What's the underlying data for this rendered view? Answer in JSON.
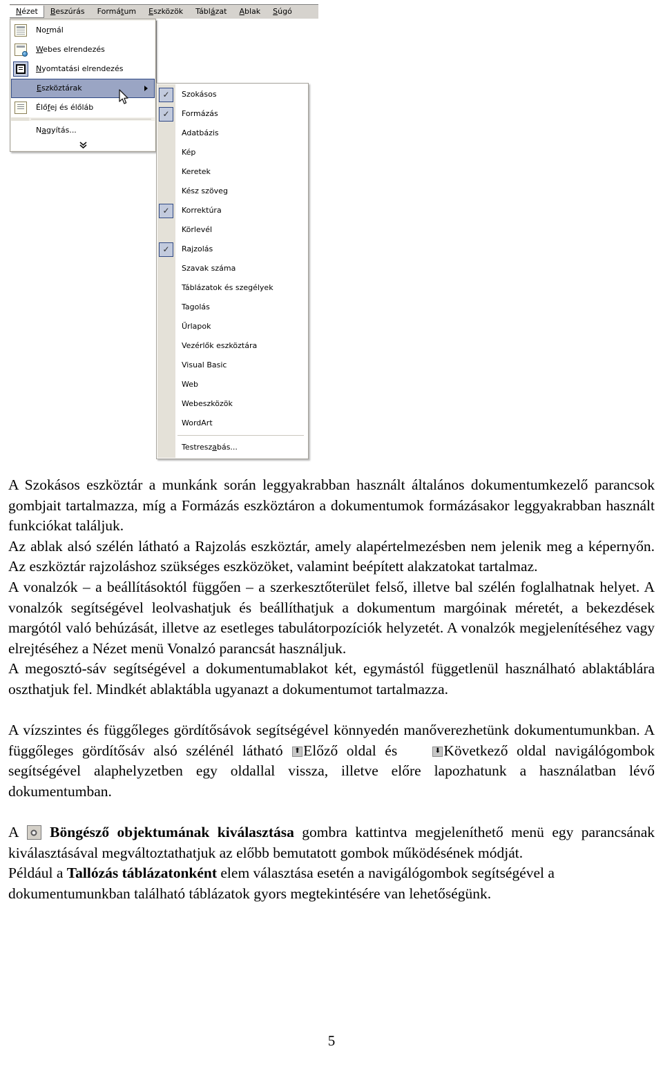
{
  "menubar": {
    "items": [
      {
        "label": "Nézet",
        "accel": "N",
        "active": true
      },
      {
        "label": "Beszúrás",
        "accel": "B",
        "active": false
      },
      {
        "label": "Formátum",
        "accel": "t",
        "active": false
      },
      {
        "label": "Eszközök",
        "accel": "E",
        "active": false
      },
      {
        "label": "Táblázat",
        "accel": "á",
        "active": false
      },
      {
        "label": "Ablak",
        "accel": "A",
        "active": false
      },
      {
        "label": "Súgó",
        "accel": "S",
        "active": false
      }
    ]
  },
  "view_menu": {
    "items": [
      {
        "label": "Normál",
        "icon": "normal-view-icon",
        "highlight": false,
        "submenu": false
      },
      {
        "label": "Webes elrendezés",
        "icon": "web-layout-icon",
        "highlight": false,
        "submenu": false
      },
      {
        "label": "Nyomtatási elrendezés",
        "icon": "print-layout-icon",
        "highlight": false,
        "submenu": false
      },
      {
        "label": "Eszköztárak",
        "icon": "",
        "highlight": true,
        "submenu": true
      },
      {
        "label": "Élőfej és élőláb",
        "icon": "header-footer-icon",
        "highlight": false,
        "submenu": false
      },
      {
        "label": "Nagyítás...",
        "icon": "",
        "highlight": false,
        "submenu": false
      }
    ],
    "expand_glyph": "⌄⌄"
  },
  "toolbars_submenu": {
    "items": [
      {
        "label": "Szokásos",
        "checked": true
      },
      {
        "label": "Formázás",
        "checked": true
      },
      {
        "label": "Adatbázis",
        "checked": false
      },
      {
        "label": "Kép",
        "checked": false
      },
      {
        "label": "Keretek",
        "checked": false
      },
      {
        "label": "Kész szöveg",
        "checked": false
      },
      {
        "label": "Korrektúra",
        "checked": true
      },
      {
        "label": "Körlevél",
        "checked": false
      },
      {
        "label": "Rajzolás",
        "checked": true
      },
      {
        "label": "Szavak száma",
        "checked": false
      },
      {
        "label": "Táblázatok és szegélyek",
        "checked": false
      },
      {
        "label": "Tagolás",
        "checked": false
      },
      {
        "label": "Űrlapok",
        "checked": false
      },
      {
        "label": "Vezérlők eszköztára",
        "checked": false
      },
      {
        "label": "Visual Basic",
        "checked": false
      },
      {
        "label": "Web",
        "checked": false
      },
      {
        "label": "Webeszközök",
        "checked": false
      },
      {
        "label": "WordArt",
        "checked": false
      }
    ],
    "customize_label": "Testreszabás...",
    "check_glyph": "✓"
  },
  "body": {
    "paragraphs": [
      "A Szokásos eszköztár a munkánk során leggyakrabban használt általános dokumentumkezelő parancsok gombjait tartalmazza, míg a Formázás eszköztáron a dokumentumok formázásakor leggyakrabban használt funkciókat találjuk.",
      "Az ablak alsó szélén látható a Rajzolás eszköztár, amely alapértelmezésben nem jelenik meg a képernyőn. Az eszköztár rajzoláshoz szükséges eszközöket, valamint beépített alakzatokat tartalmaz.",
      "A vonalzók – a beállításoktól függően – a szerkesztőterület felső, illetve bal szélén foglalhatnak helyet. A vonalzók segítségével leolvashatjuk és beállíthatjuk a dokumentum margóinak méretét, a bekezdések margótól való behúzását, illetve az esetleges tabulátorpozíciók helyzetét. A vonalzók megjelenítéséhez vagy elrejtéséhez a Nézet menü Vonalzó parancsát használjuk.",
      "A megosztó-sáv segítségével a dokumentumablakot két, egymástól függetlenül használható ablaktáblára oszthatjuk fel. Mindkét ablaktábla ugyanazt a dokumentumot tartalmazza."
    ],
    "scroll_paragraph": {
      "part1": "A vízszintes és függőleges gördítősávok segítségével könnyedén manőverezhetünk dokumentumunkban. A függőleges gördítősáv alsó szélénél látható ",
      "prev_label": "Előző oldal és",
      "prev_glyph": "⬆",
      "next_label": "Következő",
      "next_glyph": "⬇",
      "part2": " oldal navigálógombok segítségével alaphelyzetben egy oldallal vissza, illetve előre lapozhatunk a használatban lévő dokumentumban."
    },
    "browse_paragraph": {
      "lead": "A ",
      "bold_term": "Böngésző objektumának kiválasztása",
      "rest": " gombra kattintva megjeleníthető menü egy parancsának kiválasztásával megváltoztathatjuk az előbb bemutatott gombok működésének módját."
    },
    "example_paragraph": {
      "lead": "Például a ",
      "bold_term": "Tallózás táblázatonként",
      "rest": " elem választása esetén a navigálógombok segítségével a dokumentumunkban található táblázatok gyors megtekintésére van lehetőségünk."
    }
  },
  "page_number": "5",
  "colors": {
    "menubar_bg": "#d6d3ce",
    "menu_bg": "#ffffff",
    "menu_gutter": "#e4e1d8",
    "menu_border": "#a3a098",
    "highlight_bg": "#9aa5c4",
    "highlight_border": "#2f4884",
    "check_box_bg": "#c2cadd"
  }
}
